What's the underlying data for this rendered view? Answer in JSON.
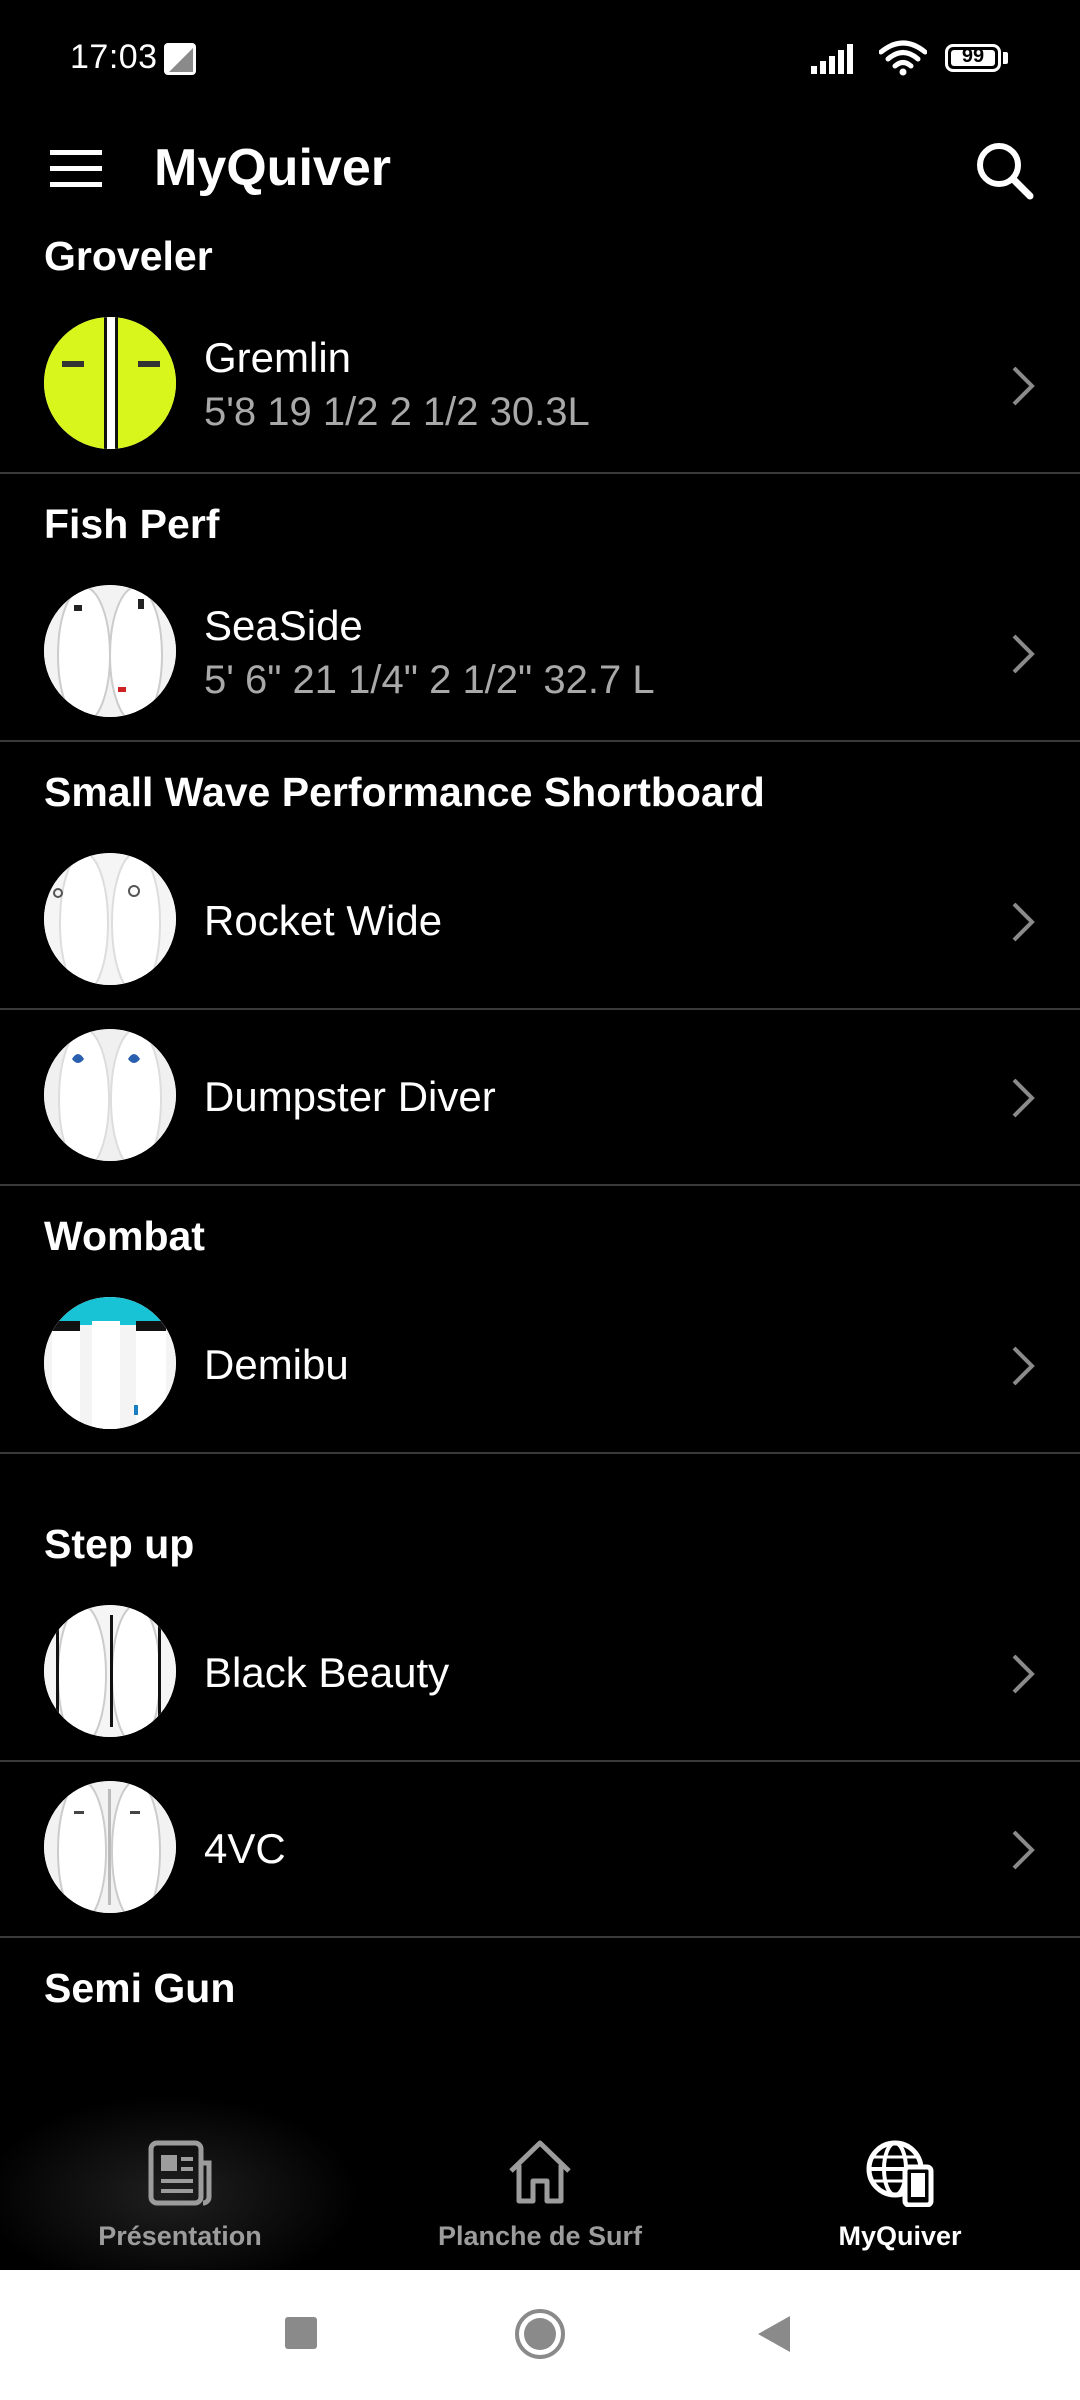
{
  "status": {
    "time": "17:03",
    "battery": "99",
    "battery_level": 0.99
  },
  "app_bar": {
    "title": "MyQuiver"
  },
  "sections": [
    {
      "title": "Groveler",
      "items": [
        {
          "name": "Gremlin",
          "sub": "5'8 19 1/2 2 1/2 30.3L"
        }
      ]
    },
    {
      "title": "Fish Perf",
      "items": [
        {
          "name": "SeaSide",
          "sub": "5' 6\" 21 1/4\" 2 1/2\" 32.7 L"
        }
      ]
    },
    {
      "title": "Small Wave Performance Shortboard",
      "items": [
        {
          "name": "Rocket Wide"
        },
        {
          "name": "Dumpster Diver"
        }
      ]
    },
    {
      "title": "Wombat",
      "items": [
        {
          "name": "Demibu"
        }
      ]
    },
    {
      "title": "Step up",
      "items": [
        {
          "name": "Black Beauty"
        },
        {
          "name": "4VC"
        }
      ]
    },
    {
      "title": "Semi Gun",
      "items": []
    }
  ],
  "bottom_nav": [
    {
      "label": "Présentation",
      "icon": "newspaper-icon",
      "active": false
    },
    {
      "label": "Planche de Surf",
      "icon": "home-icon",
      "active": false
    },
    {
      "label": "MyQuiver",
      "icon": "globe-device-icon",
      "active": true
    }
  ],
  "colors": {
    "background": "#000000",
    "subtitle": "#a9a9a9",
    "divider": "#3a3a3a",
    "inactive_nav": "#9c9c9c",
    "gremlin_board": "#d8f51c"
  }
}
